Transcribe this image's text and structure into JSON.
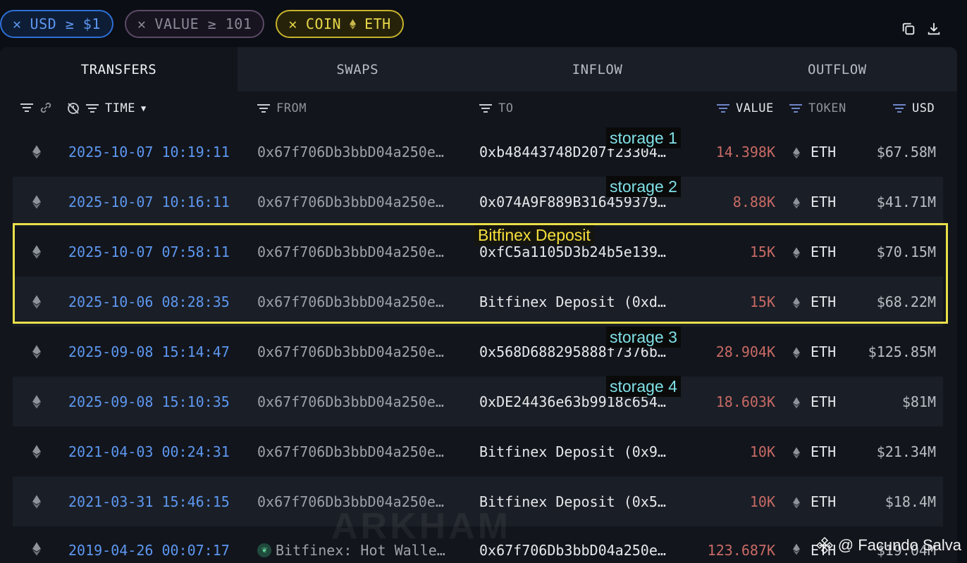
{
  "filters": [
    {
      "label": "USD ≥ $1"
    },
    {
      "label": "VALUE ≥ 101"
    },
    {
      "label": "COIN",
      "value": "ETH"
    }
  ],
  "tabs": [
    "TRANSFERS",
    "SWAPS",
    "INFLOW",
    "OUTFLOW"
  ],
  "columns": {
    "time": "TIME",
    "from": "FROM",
    "to": "TO",
    "value": "VALUE",
    "token": "TOKEN",
    "usd": "USD"
  },
  "rows": [
    {
      "time": "2025-10-07 10:19:11",
      "from": "0x67f706Db3bbD04a250e…",
      "to": "0xb48443748D207f23304…",
      "value": "14.398K",
      "token": "ETH",
      "usd": "$67.58M"
    },
    {
      "time": "2025-10-07 10:16:11",
      "from": "0x67f706Db3bbD04a250e…",
      "to": "0x074A9F889B316459379…",
      "value": "8.88K",
      "token": "ETH",
      "usd": "$41.71M"
    },
    {
      "time": "2025-10-07 07:58:11",
      "from": "0x67f706Db3bbD04a250e…",
      "to": "0xfC5a1105D3b24b5e139…",
      "value": "15K",
      "token": "ETH",
      "usd": "$70.15M"
    },
    {
      "time": "2025-10-06 08:28:35",
      "from": "0x67f706Db3bbD04a250e…",
      "to": "Bitfinex Deposit (0xd…",
      "value": "15K",
      "token": "ETH",
      "usd": "$68.22M"
    },
    {
      "time": "2025-09-08 15:14:47",
      "from": "0x67f706Db3bbD04a250e…",
      "to": "0x568D688295888f7376b…",
      "value": "28.904K",
      "token": "ETH",
      "usd": "$125.85M"
    },
    {
      "time": "2025-09-08 15:10:35",
      "from": "0x67f706Db3bbD04a250e…",
      "to": "0xDE24436e63b9918c654…",
      "value": "18.603K",
      "token": "ETH",
      "usd": "$81M"
    },
    {
      "time": "2021-04-03 00:24:31",
      "from": "0x67f706Db3bbD04a250e…",
      "to": "Bitfinex Deposit (0x9…",
      "value": "10K",
      "token": "ETH",
      "usd": "$21.34M"
    },
    {
      "time": "2021-03-31 15:46:15",
      "from": "0x67f706Db3bbD04a250e…",
      "to": "Bitfinex Deposit (0x5…",
      "value": "10K",
      "token": "ETH",
      "usd": "$18.4M"
    },
    {
      "time": "2019-04-26 00:07:17",
      "from": "Bitfinex: Hot Walle…",
      "to": "0x67f706Db3bbD04a250e…",
      "value": "123.687K",
      "token": "ETH",
      "usd": "$19.04M"
    }
  ],
  "annotations": {
    "storage1": "storage 1",
    "storage2": "storage 2",
    "bitfinex": "Bitfinex Deposit",
    "storage3": "storage 3",
    "storage4": "storage 4"
  },
  "watermark": "ARKHAM",
  "credit": "@ Facundo Salva",
  "colors": {
    "accent_blue": "#5d97f0",
    "value_red": "#c86a65",
    "highlight": "#e9e04a",
    "annotation_cyan": "#7fe0e6"
  }
}
